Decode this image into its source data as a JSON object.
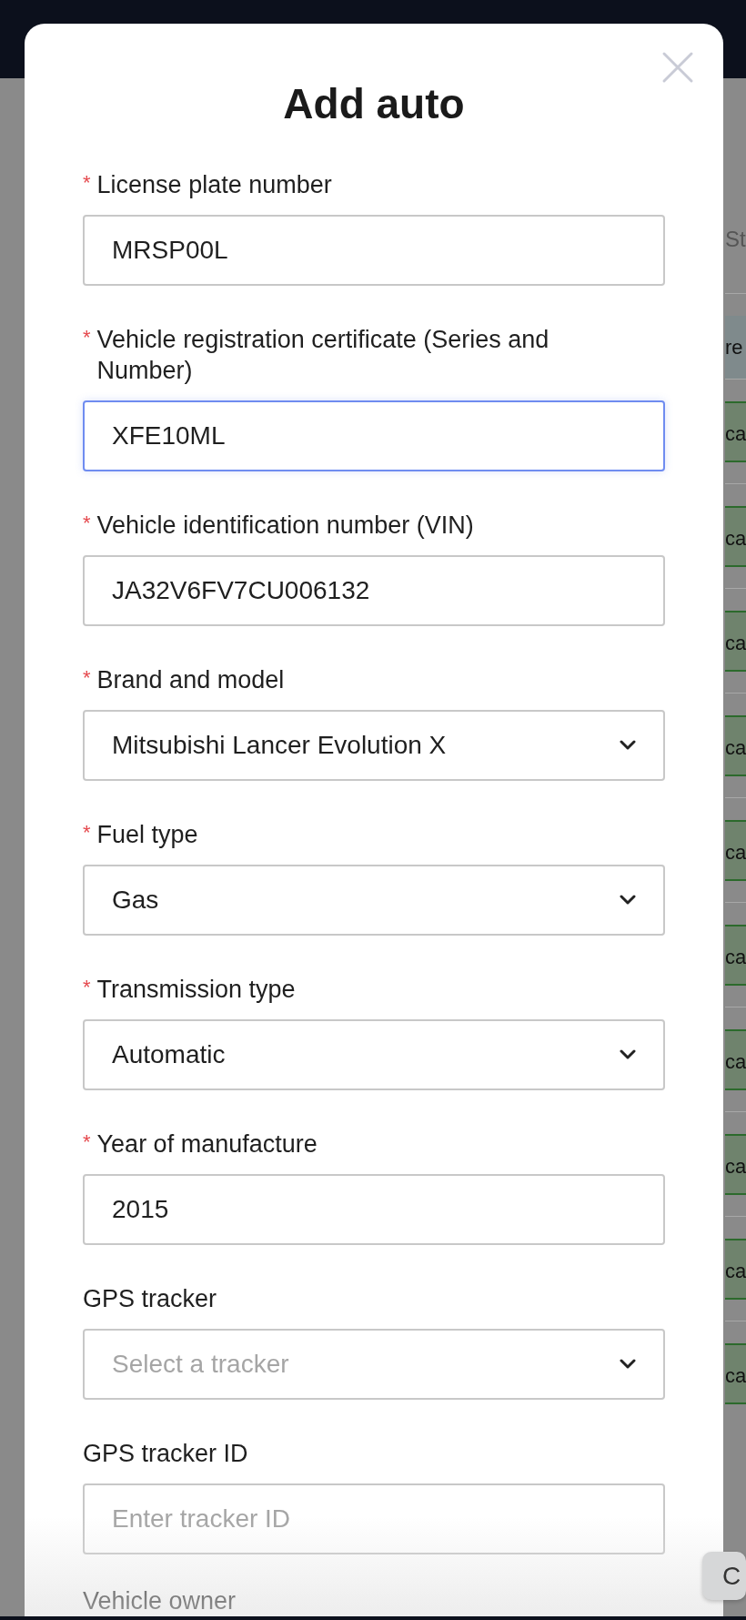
{
  "background": {
    "column_heading": "St",
    "highlighted_cell": "re",
    "cells": [
      "ca",
      "ca",
      "ca",
      "ca",
      "ca",
      "ca",
      "ca",
      "ca",
      "ca",
      "ca"
    ],
    "floating_button": "C"
  },
  "modal": {
    "title": "Add auto",
    "fields": [
      {
        "kind": "text",
        "required_mark": "*",
        "label": "License plate number",
        "value": "MRSP00L",
        "focused": false
      },
      {
        "kind": "text",
        "required_mark": "*",
        "label": "Vehicle registration certificate (Series and Number)",
        "value": "XFE10ML",
        "focused": true
      },
      {
        "kind": "text",
        "required_mark": "*",
        "label": "Vehicle identification number (VIN)",
        "value": "JA32V6FV7CU006132",
        "focused": false
      },
      {
        "kind": "select",
        "required_mark": "*",
        "label": "Brand and model",
        "value": "Mitsubishi Lancer Evolution X",
        "focused": false
      },
      {
        "kind": "select",
        "required_mark": "*",
        "label": "Fuel type",
        "value": "Gas",
        "focused": false
      },
      {
        "kind": "select",
        "required_mark": "*",
        "label": "Transmission type",
        "value": "Automatic",
        "focused": false
      },
      {
        "kind": "text",
        "required_mark": "*",
        "label": "Year of manufacture",
        "value": "2015",
        "focused": false
      },
      {
        "kind": "select",
        "label": "GPS tracker",
        "placeholder": "Select a tracker",
        "focused": false
      },
      {
        "kind": "text",
        "label": "GPS tracker ID",
        "placeholder": "Enter tracker ID",
        "focused": false
      }
    ],
    "cut_label": "Vehicle owner"
  }
}
